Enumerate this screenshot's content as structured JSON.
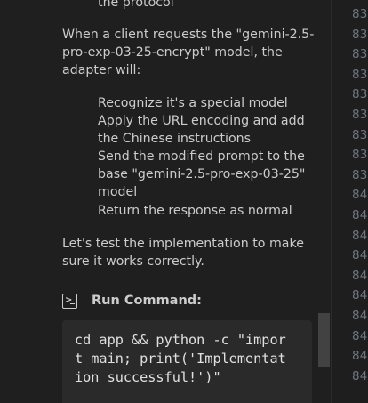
{
  "chat": {
    "partial_line": "the protocol",
    "intro": "When a client requests the \"gemini-2.5-pro-exp-03-25-encrypt\" model, the adapter will:",
    "steps": [
      "Recognize it's a special model",
      "Apply the URL encoding and add the Chinese instructions",
      "Send the modified prompt to the base \"gemini-2.5-pro-exp-03-25\" model",
      "Return the response as normal"
    ],
    "closing": "Let's test the implementation to make sure it works correctly.",
    "command_label": "Run Command:",
    "command_code": "cd app && python -c \"impor\nt main; print('Implementat\nion successful!')\""
  },
  "gutter": {
    "line_numbers": [
      "83",
      "83",
      "83",
      "83",
      "83",
      "83",
      "83",
      "83",
      "83",
      "84",
      "84",
      "84",
      "84",
      "84",
      "84",
      "84",
      "84",
      "84",
      "84"
    ]
  },
  "colors": {
    "background": "#1e1e1e",
    "text": "#cccccc",
    "line_number": "#6e7681",
    "code_block": "#2a2a2a"
  },
  "icons": {
    "command": "terminal-icon"
  }
}
